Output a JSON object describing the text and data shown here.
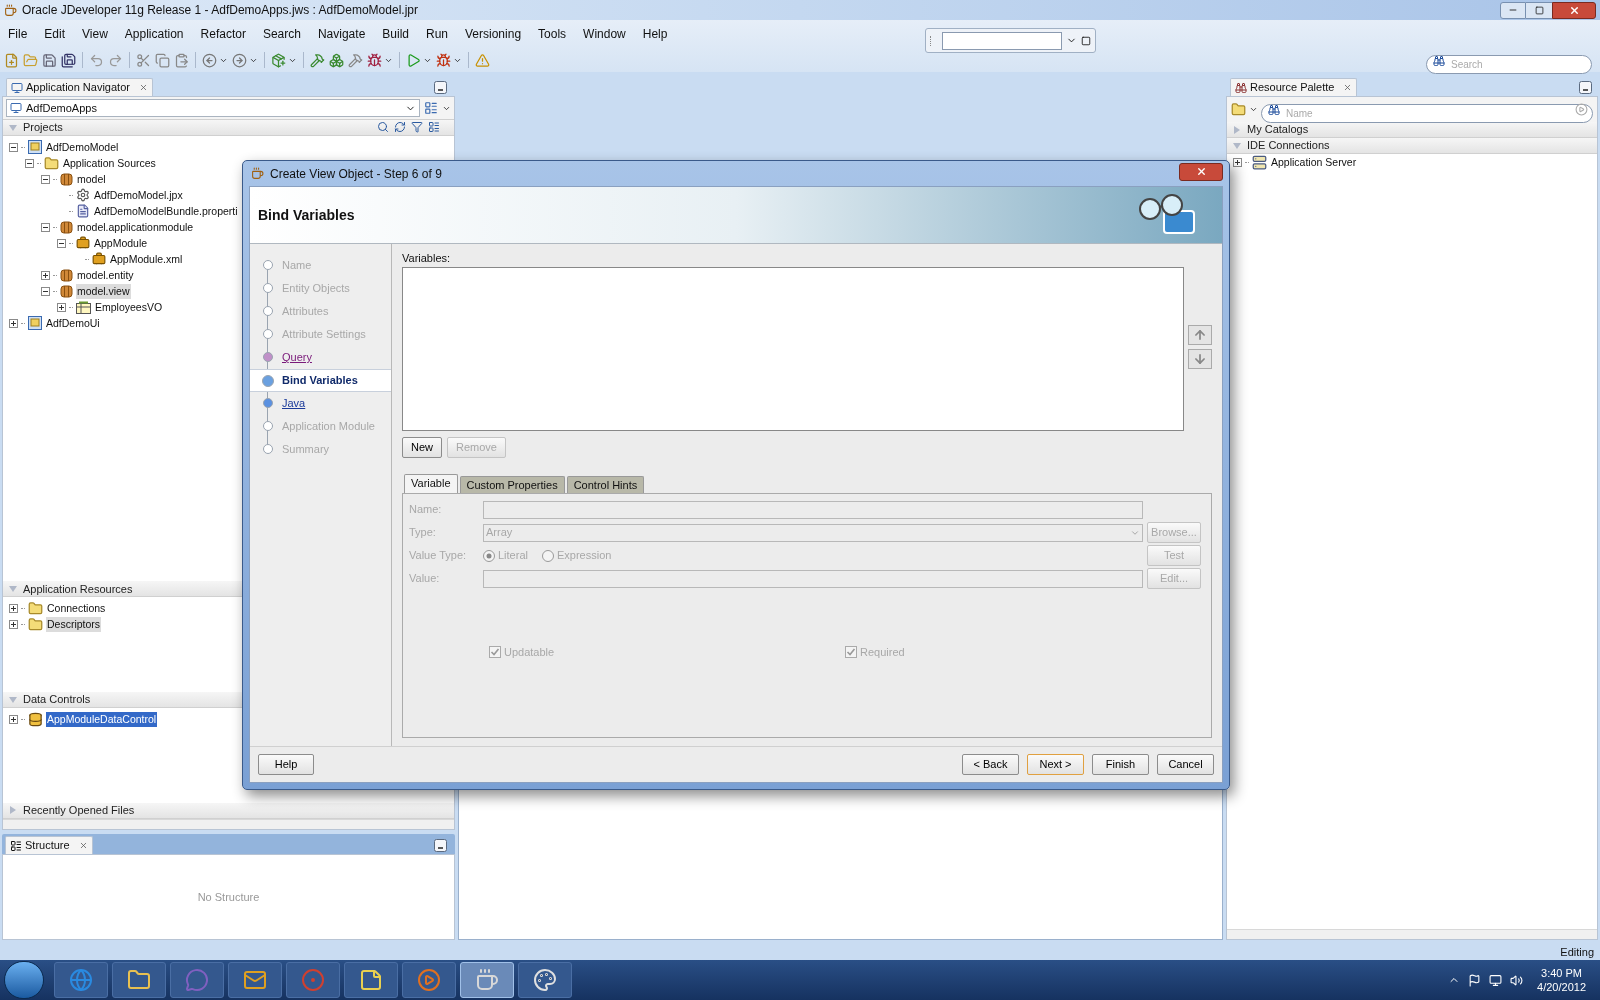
{
  "window": {
    "title": "Oracle JDeveloper 11g Release 1 - AdfDemoApps.jws : AdfDemoModel.jpr"
  },
  "menu": [
    {
      "label": "File"
    },
    {
      "label": "Edit"
    },
    {
      "label": "View"
    },
    {
      "label": "Application"
    },
    {
      "label": "Refactor"
    },
    {
      "label": "Search"
    },
    {
      "label": "Navigate"
    },
    {
      "label": "Build"
    },
    {
      "label": "Run"
    },
    {
      "label": "Versioning"
    },
    {
      "label": "Tools"
    },
    {
      "label": "Window"
    },
    {
      "label": "Help"
    }
  ],
  "toolbar_search": {
    "placeholder": "Search"
  },
  "navigator": {
    "tab": "Application Navigator",
    "application": "AdfDemoApps",
    "sections": [
      {
        "title": "Projects",
        "expanded": true,
        "tree": [
          {
            "label": "AdfDemoModel",
            "kind": "project",
            "expanded": true,
            "selected": false,
            "children": [
              {
                "label": "Application Sources",
                "kind": "folder",
                "expanded": true,
                "selected": false,
                "children": [
                  {
                    "label": "model",
                    "kind": "package",
                    "expanded": true,
                    "selected": false,
                    "children": [
                      {
                        "label": "AdfDemoModel.jpx",
                        "kind": "config",
                        "selected": false
                      },
                      {
                        "label": "AdfDemoModelBundle.properti",
                        "kind": "props",
                        "selected": false
                      }
                    ]
                  },
                  {
                    "label": "model.applicationmodule",
                    "kind": "package",
                    "expanded": true,
                    "selected": false,
                    "children": [
                      {
                        "label": "AppModule",
                        "kind": "module",
                        "expanded": true,
                        "selected": false,
                        "children": [
                          {
                            "label": "AppModule.xml",
                            "kind": "module",
                            "selected": false
                          }
                        ]
                      }
                    ]
                  },
                  {
                    "label": "model.entity",
                    "kind": "package",
                    "expanded": false,
                    "selected": false
                  },
                  {
                    "label": "model.view",
                    "kind": "package",
                    "expanded": true,
                    "selected": true,
                    "focused": false,
                    "children": [
                      {
                        "label": "EmployeesVO",
                        "kind": "vo",
                        "expanded": false,
                        "selected": false
                      }
                    ]
                  }
                ]
              }
            ]
          },
          {
            "label": "AdfDemoUi",
            "kind": "project",
            "expanded": false,
            "selected": false
          }
        ]
      },
      {
        "title": "Application Resources",
        "expanded": true,
        "tree": [
          {
            "label": "Connections",
            "kind": "folder",
            "expanded": false,
            "selected": false
          },
          {
            "label": "Descriptors",
            "kind": "folder",
            "expanded": false,
            "selected": true,
            "focused": false
          }
        ]
      },
      {
        "title": "Data Controls",
        "expanded": true,
        "tree": [
          {
            "label": "AppModuleDataControl",
            "kind": "datacontrol",
            "expanded": false,
            "selected": true,
            "focused": true
          }
        ]
      },
      {
        "title": "Recently Opened Files",
        "expanded": false
      }
    ]
  },
  "structure": {
    "tab": "Structure",
    "empty_text": "No Structure"
  },
  "resource_palette": {
    "tab": "Resource Palette",
    "search": {
      "placeholder": "Name"
    },
    "sections": [
      {
        "title": "My Catalogs",
        "expanded": false
      },
      {
        "title": "IDE Connections",
        "expanded": true,
        "tree": [
          {
            "label": "Application Server",
            "kind": "server",
            "expanded": false,
            "selected": false
          }
        ]
      }
    ]
  },
  "dialog": {
    "title": "Create View Object - Step 6 of 9",
    "heading": "Bind Variables",
    "steps": [
      {
        "label": "Name",
        "kind": "disabled",
        "selected": false
      },
      {
        "label": "Entity Objects",
        "kind": "disabled",
        "selected": false
      },
      {
        "label": "Attributes",
        "kind": "disabled",
        "selected": false
      },
      {
        "label": "Attribute Settings",
        "kind": "disabled",
        "selected": false
      },
      {
        "label": "Query",
        "kind": "visited",
        "selected": false
      },
      {
        "label": "Bind Variables",
        "kind": "current",
        "selected": true
      },
      {
        "label": "Java",
        "kind": "link",
        "selected": false
      },
      {
        "label": "Application Module",
        "kind": "disabled",
        "selected": false
      },
      {
        "label": "Summary",
        "kind": "disabled",
        "selected": false
      }
    ],
    "variables_label": "Variables:",
    "list_buttons": [
      {
        "label": "New",
        "disabled": false
      },
      {
        "label": "Remove",
        "disabled": true
      }
    ],
    "tabs": [
      {
        "label": "Variable",
        "selected": true
      },
      {
        "label": "Custom Properties",
        "selected": false
      },
      {
        "label": "Control Hints",
        "selected": false
      }
    ],
    "form": [
      {
        "label": "Name:",
        "kind": "text",
        "disabled": true
      },
      {
        "label": "Type:",
        "kind": "select",
        "value": "Array",
        "disabled": true,
        "button": {
          "label": "Browse...",
          "disabled": true
        }
      },
      {
        "label": "Value Type:",
        "kind": "radio",
        "disabled": true,
        "options": [
          {
            "label": "Literal",
            "selected": true
          },
          {
            "label": "Expression",
            "selected": false
          }
        ],
        "button": {
          "label": "Test",
          "disabled": true
        }
      },
      {
        "label": "Value:",
        "kind": "text",
        "disabled": true,
        "button": {
          "label": "Edit...",
          "disabled": true
        }
      }
    ],
    "checkboxes": [
      {
        "label": "Updatable",
        "checked": true,
        "disabled": true
      },
      {
        "label": "Required",
        "checked": true,
        "disabled": true
      }
    ],
    "help_button": "Help",
    "buttons": [
      {
        "label": "< Back",
        "default": false
      },
      {
        "label": "Next >",
        "default": true
      },
      {
        "label": "Finish",
        "default": false
      },
      {
        "label": "Cancel",
        "default": false
      }
    ]
  },
  "status_bar": {
    "text": "Editing"
  },
  "taskbar": {
    "time": "3:40 PM",
    "date": "4/20/2012"
  }
}
